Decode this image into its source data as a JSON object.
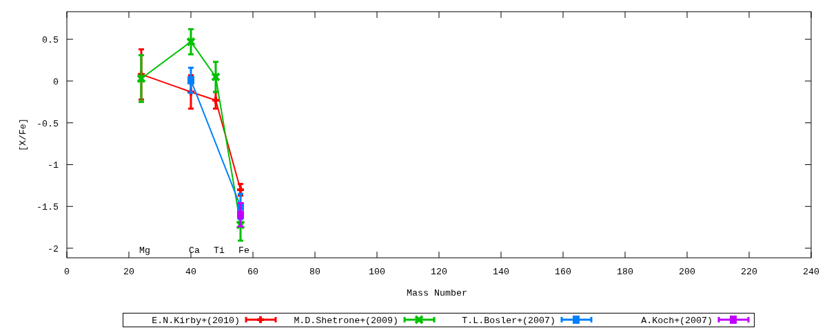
{
  "chart": {
    "chart_data": {
      "type": "line",
      "xlabel": "Mass Number",
      "ylabel": "[X/Fe]",
      "xlim": [
        0,
        240
      ],
      "ylim": [
        -2.115,
        0.83
      ],
      "xticks": [
        0,
        20,
        40,
        60,
        80,
        100,
        120,
        140,
        160,
        180,
        200,
        220,
        240
      ],
      "yticks": [
        0.5,
        0,
        -0.5,
        -1,
        -1.5,
        -2
      ],
      "legend": true,
      "series": [
        {
          "name": "E.N.Kirby+(2010)",
          "color": "#ff0000",
          "marker": "plus",
          "x": [
            24,
            40,
            48,
            56
          ],
          "values": [
            0.08,
            -0.13,
            -0.23,
            -1.3
          ],
          "errors": [
            0.3,
            0.2,
            0.1,
            0.07
          ]
        },
        {
          "name": "M.D.Shetrone+(2009)",
          "color": "#00c000",
          "marker": "cross",
          "x": [
            24,
            40,
            48,
            56
          ],
          "values": [
            0.03,
            0.47,
            0.05,
            -1.72
          ],
          "errors": [
            0.28,
            0.15,
            0.18,
            0.19
          ]
        },
        {
          "name": "T.L.Bosler+(2007)",
          "color": "#0080ff",
          "marker": "square",
          "x": [
            40,
            56
          ],
          "values": [
            0.01,
            -1.5
          ],
          "errors": [
            0.15,
            0.15
          ]
        },
        {
          "name": "A.Koch+(2007)",
          "color": "#c000ff",
          "marker": "square",
          "x": [
            56
          ],
          "values": [
            -1.6
          ],
          "errors": [
            0.14
          ]
        }
      ],
      "annotations": [
        "Mg",
        "Ca",
        "Ti",
        "Fe"
      ]
    }
  }
}
